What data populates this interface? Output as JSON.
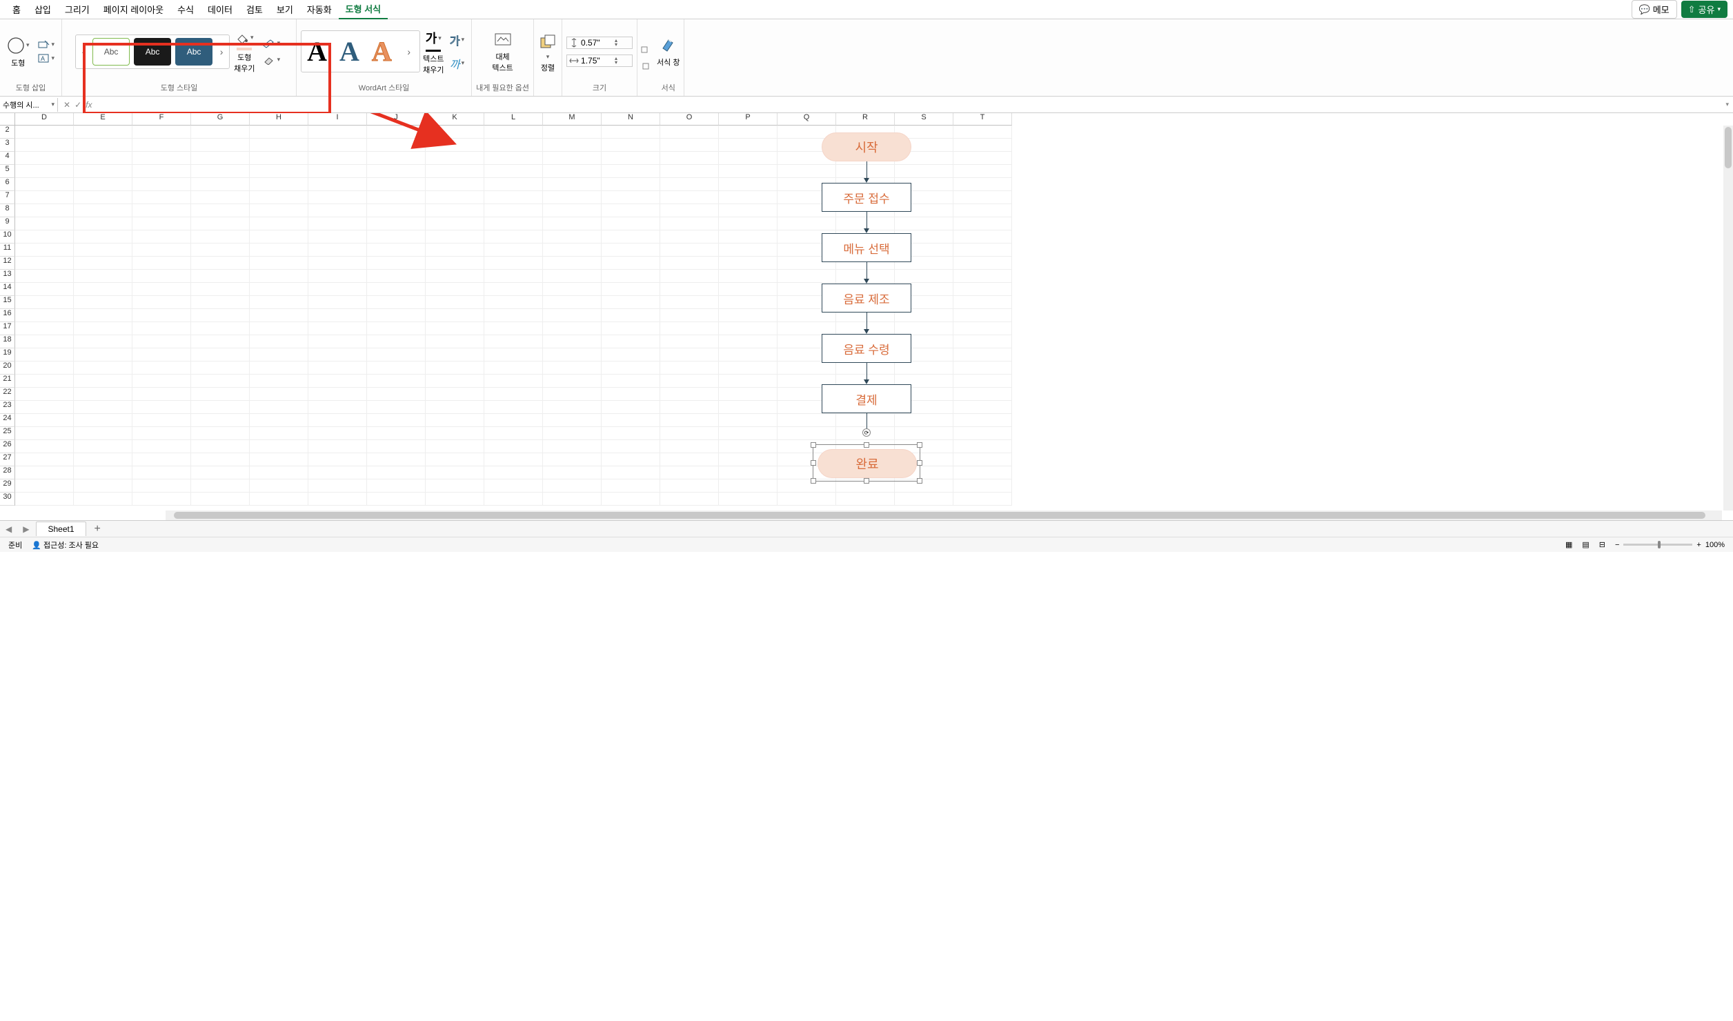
{
  "menubar": {
    "items": [
      "홈",
      "삽입",
      "그리기",
      "페이지 레이아웃",
      "수식",
      "데이터",
      "검토",
      "보기",
      "자동화",
      "도형 서식"
    ],
    "active_index": 9,
    "memo": "메모",
    "share": "공유"
  },
  "ribbon": {
    "shape_insert": {
      "label": "도형",
      "group_label": "도형 삽입"
    },
    "shape_styles": {
      "group_label": "도형 스타일",
      "preview_text": "Abc",
      "fill_label": "도형\n채우기"
    },
    "wordart": {
      "group_label": "WordArt 스타일",
      "letter": "A",
      "text_fill_label": "텍스트\n채우기",
      "ga": "가",
      "ga2": "가",
      "ka": "까"
    },
    "options": {
      "alt_text": "대체\n텍스트",
      "group_label": "내게 필요한 옵션"
    },
    "arrange": {
      "label": "정렬"
    },
    "size": {
      "group_label": "크기",
      "height": "0.57\"",
      "width": "1.75\""
    },
    "format": {
      "label": "서식 창",
      "group_label": "서식"
    }
  },
  "formula_bar": {
    "name_box": "수행의 시...",
    "fx": "fx"
  },
  "grid": {
    "columns": [
      "D",
      "E",
      "F",
      "G",
      "H",
      "I",
      "J",
      "K",
      "L",
      "M",
      "N",
      "O",
      "P",
      "Q",
      "R",
      "S",
      "T"
    ],
    "rows": [
      "2",
      "3",
      "4",
      "5",
      "6",
      "7",
      "8",
      "9",
      "10",
      "11",
      "12",
      "13",
      "14",
      "15",
      "16",
      "17",
      "18",
      "19",
      "20",
      "21",
      "22",
      "23",
      "24",
      "25",
      "26",
      "27",
      "28",
      "29",
      "30"
    ]
  },
  "flowchart": {
    "start": "시작",
    "steps": [
      "주문 접수",
      "메뉴 선택",
      "음료 제조",
      "음료 수령",
      "결제"
    ],
    "end": "완료"
  },
  "sheet_bar": {
    "tab": "Sheet1"
  },
  "status_bar": {
    "ready": "준비",
    "accessibility": "접근성: 조사 필요",
    "zoom": "100%"
  }
}
